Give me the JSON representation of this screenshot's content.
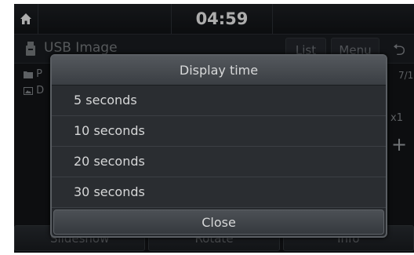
{
  "status_bar": {
    "home_icon": "home-icon",
    "clock": "04:59"
  },
  "title_bar": {
    "source_icon": "usb-icon",
    "source_title": "USB Image",
    "list_label": "List",
    "menu_label": "Menu",
    "back_icon": "back-icon",
    "back_glyph": "⮌"
  },
  "background": {
    "folder_icon": "folder-icon",
    "folder_text": "P",
    "photo_icon": "photo-icon",
    "photo_text": "D",
    "page_count": "7/1",
    "zoom_level": "x1",
    "zoom_in": "+"
  },
  "bottom_bar": {
    "slideshow": "Slideshow",
    "rotate": "Rotate",
    "info": "Info"
  },
  "dialog": {
    "title": "Display time",
    "options": [
      "5 seconds",
      "10 seconds",
      "20 seconds",
      "30 seconds"
    ],
    "close_label": "Close"
  },
  "colors": {
    "screen_bg": "#141619",
    "dialog_bg": "#26292d",
    "dialog_border": "#5a5e63",
    "text": "#d6d7d8"
  }
}
